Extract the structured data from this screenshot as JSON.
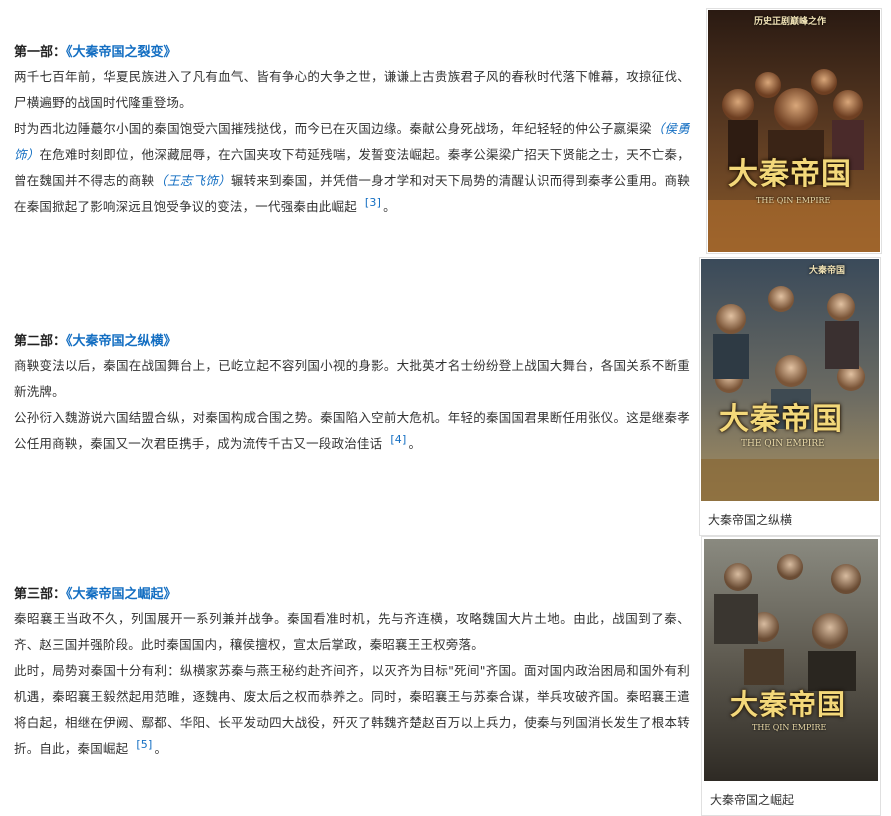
{
  "sections": [
    {
      "title_prefix": "第一部：",
      "title_open": "《",
      "title": "大秦帝国之裂变",
      "title_close": "》",
      "paragraphs": [
        "两千七百年前，华夏民族进入了凡有血气、皆有争心的大争之世，谦谦上古贵族君子风的春秋时代落下帷幕，攻掠征伐、尸横遍野的战国时代隆重登场。"
      ],
      "p2_before": "时为西北边陲蕞尔小国的秦国饱受六国摧残挞伐，而今已在灭国边缘。秦献公身死战场，年纪轻轻的仲公子嬴渠梁",
      "p2_link1": "（侯勇饰）",
      "p2_mid": "在危难时刻即位，他深藏屈辱，在六国夹攻下苟延残喘，发誓变法崛起。秦孝公渠梁广招天下贤能之士，天不亡秦，曾在魏国并不得志的商鞅",
      "p2_link2": "（王志飞饰）",
      "p2_after": "辗转来到秦国，并凭借一身才学和对天下局势的清醒认识而得到秦孝公重用。商鞅在秦国掀起了影响深远且饱受争议的变法，一代强秦由此崛起",
      "ref": "[3]",
      "end": "。"
    },
    {
      "title_prefix": "第二部：",
      "title_open": "《",
      "title": "大秦帝国之纵横",
      "title_close": "》",
      "paragraphs": [
        "商鞅变法以后，秦国在战国舞台上，已屹立起不容列国小视的身影。大批英才名士纷纷登上战国大舞台，各国关系不断重新洗牌。"
      ],
      "last": "公孙衍入魏游说六国结盟合纵，对秦国构成合围之势。秦国陷入空前大危机。年轻的秦国国君果断任用张仪。这是继秦孝公任用商鞅，秦国又一次君臣携手，成为流传千古又一段政治佳话",
      "ref": "[4]",
      "end": "。"
    },
    {
      "title_prefix": "第三部：",
      "title_open": "《",
      "title": "大秦帝国之崛起",
      "title_close": "》",
      "paragraphs": [
        "秦昭襄王当政不久，列国展开一系列兼并战争。秦国看准时机，先与齐连横，攻略魏国大片土地。由此，战国到了秦、齐、赵三国并强阶段。此时秦国国内，穰侯擅权，宣太后掌政，秦昭襄王王权旁落。"
      ],
      "last": "此时，局势对秦国十分有利：纵横家苏秦与燕王秘约赴齐间齐，以灭齐为目标\"死间\"齐国。面对国内政治困局和国外有利机遇，秦昭襄王毅然起用范睢，逐魏冉、废太后之权而恭养之。同时，秦昭襄王与苏秦合谋，举兵攻破齐国。秦昭襄王遣将白起，相继在伊阙、鄢都、华阳、长平发动四大战役，歼灭了韩魏齐楚赵百万以上兵力，使秦与列国消长发生了根本转折。自此，秦国崛起",
      "ref": "[5]",
      "end": "。"
    }
  ],
  "posters": [
    {
      "caption": "",
      "title_art": "大秦帝国",
      "subtitle": "THE QIN EMPIRE",
      "top_text": "历史正剧巅峰之作"
    },
    {
      "caption": "大秦帝国之纵横",
      "title_art": "大秦帝国",
      "subtitle": "THE QIN EMPIRE",
      "top_text": "大秦帝国"
    },
    {
      "caption": "大秦帝国之崛起",
      "title_art": "大秦帝国",
      "subtitle": "THE QIN EMPIRE",
      "top_text": ""
    }
  ],
  "colors": {
    "link": "#136ec2",
    "text": "#333333",
    "poster_gold": "#f3d87a"
  }
}
